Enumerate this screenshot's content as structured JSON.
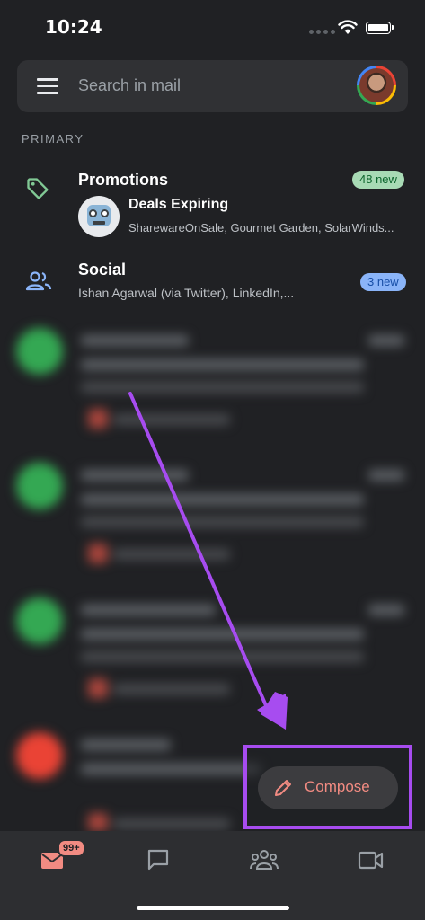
{
  "status_bar": {
    "time": "10:24"
  },
  "search": {
    "placeholder": "Search in mail"
  },
  "section": {
    "label": "PRIMARY"
  },
  "categories": {
    "promotions": {
      "title": "Promotions",
      "badge": "48 new",
      "sender_title": "Deals Expiring",
      "senders": "SharewareOnSale, Gourmet Garden, SolarWinds..."
    },
    "social": {
      "title": "Social",
      "badge": "3 new",
      "senders": "Ishan Agarwal (via Twitter), LinkedIn,..."
    }
  },
  "compose": {
    "label": "Compose"
  },
  "bottom_nav": {
    "mail_badge": "99+",
    "icons": [
      "mail-icon",
      "chat-icon",
      "spaces-icon",
      "meet-video-icon"
    ]
  },
  "colors": {
    "background": "#202124",
    "annotation_purple": "#a74cf0",
    "compose_accent": "#f28b82",
    "promo_badge": "#a8dab5",
    "social_badge": "#8ab4f8"
  }
}
